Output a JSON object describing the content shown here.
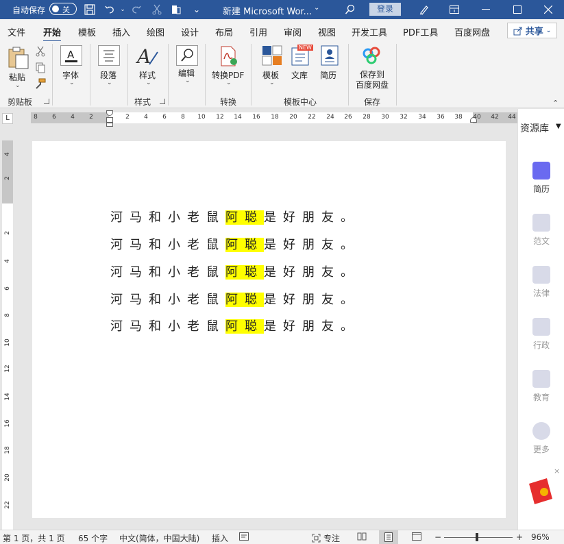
{
  "titlebar": {
    "autosave_label": "自动保存",
    "autosave_state": "关",
    "doc_title": "新建 Microsoft Wor...",
    "login_label": "登录",
    "icons": [
      "save-icon",
      "undo-icon",
      "redo-icon",
      "cut-icon",
      "touch-mode-icon",
      "more-icon",
      "search-icon",
      "pen-icon",
      "ribbon-display-icon",
      "minimize-icon",
      "maximize-icon",
      "close-icon"
    ]
  },
  "menu": {
    "tabs": [
      "文件",
      "开始",
      "模板",
      "插入",
      "绘图",
      "设计",
      "布局",
      "引用",
      "审阅",
      "视图",
      "开发工具",
      "PDF工具",
      "百度网盘"
    ],
    "active": "开始",
    "share_label": "共享"
  },
  "ribbon": {
    "paste_label": "粘贴",
    "clipboard_group": "剪贴板",
    "font_label": "字体",
    "paragraph_label": "段落",
    "styles_label": "样式",
    "styles_group": "样式",
    "edit_label": "编辑",
    "to_pdf_label": "转换PDF",
    "convert_group": "转换",
    "template_label": "模板",
    "library_label": "文库",
    "resume_label": "简历",
    "template_center_group": "模板中心",
    "new_badge": "NEW",
    "save_to_label_1": "保存到",
    "save_to_label_2": "百度网盘",
    "save_group": "保存"
  },
  "ruler": {
    "corner": "L",
    "left_numbers": [
      "8",
      "6",
      "4",
      "2"
    ],
    "right_numbers": [
      "2",
      "4",
      "6",
      "8",
      "10",
      "12",
      "14",
      "16",
      "18",
      "20",
      "22",
      "24",
      "26",
      "28",
      "30",
      "32",
      "34",
      "36",
      "38",
      "40",
      "42",
      "44"
    ],
    "vertical_numbers": [
      "4",
      "2",
      "2",
      "4",
      "6",
      "8",
      "10",
      "12",
      "14",
      "16",
      "18",
      "20",
      "22"
    ]
  },
  "document": {
    "lines": [
      {
        "before": "河马和小老鼠",
        "highlight": "阿聪",
        "after": "是好朋友。"
      },
      {
        "before": "河马和小老鼠",
        "highlight": "阿聪",
        "after": "是好朋友。"
      },
      {
        "before": "河马和小老鼠",
        "highlight": "阿聪",
        "after": "是好朋友。"
      },
      {
        "before": "河马和小老鼠",
        "highlight": "阿聪",
        "after": "是好朋友。"
      },
      {
        "before": "河马和小老鼠",
        "highlight": "阿聪",
        "after": "是好朋友。"
      }
    ],
    "highlight_color": "#ffff00"
  },
  "resource_pane": {
    "title": "资源库",
    "items": [
      {
        "label": "简历",
        "icon": "resume-icon",
        "color": "#6a6af0",
        "active": true
      },
      {
        "label": "范文",
        "icon": "sample-doc-icon",
        "color": "#d8dae8",
        "active": false
      },
      {
        "label": "法律",
        "icon": "law-icon",
        "color": "#d8dae8",
        "active": false
      },
      {
        "label": "行政",
        "icon": "admin-icon",
        "color": "#d8dae8",
        "active": false
      },
      {
        "label": "教育",
        "icon": "education-icon",
        "color": "#d8dae8",
        "active": false
      },
      {
        "label": "更多",
        "icon": "more-dots-icon",
        "color": "#d8dae8",
        "active": false
      }
    ]
  },
  "statusbar": {
    "page_info": "第 1 页，共 1 页",
    "word_count": "65 个字",
    "language": "中文(简体，中国大陆)",
    "insert_mode": "插入",
    "focus_label": "专注",
    "zoom_minus": "−",
    "zoom_plus": "+",
    "zoom_value": "96%"
  },
  "colors": {
    "accent": "#2b579a",
    "ribbon_bg": "#f3f3f3"
  }
}
